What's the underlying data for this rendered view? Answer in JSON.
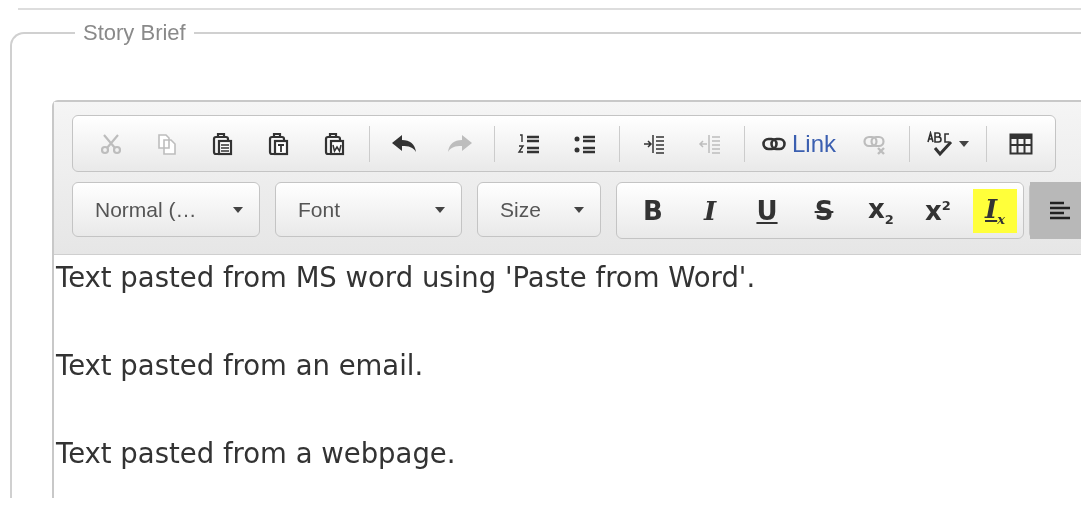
{
  "fieldset": {
    "legend": "Story Brief"
  },
  "toolbar": {
    "row_1": [
      {
        "kind": "button",
        "disabled": true
      },
      {
        "kind": "button",
        "disabled": true
      },
      {
        "kind": "button",
        "disabled": false
      },
      {
        "kind": "button",
        "disabled": false
      },
      {
        "kind": "button",
        "disabled": false
      },
      {
        "kind": "separator"
      },
      {
        "kind": "button",
        "disabled": false
      },
      {
        "kind": "button",
        "disabled": true
      },
      {
        "kind": "separator"
      },
      {
        "kind": "button",
        "disabled": false
      },
      {
        "kind": "button",
        "disabled": false
      },
      {
        "kind": "separator"
      },
      {
        "kind": "button",
        "disabled": false
      },
      {
        "kind": "button",
        "disabled": true
      },
      {
        "kind": "separator"
      },
      {
        "kind": "button",
        "label": "Link",
        "disabled": false
      },
      {
        "kind": "button",
        "disabled": true
      },
      {
        "kind": "separator"
      },
      {
        "kind": "menu-button",
        "disabled": false
      },
      {
        "kind": "separator"
      },
      {
        "kind": "button",
        "disabled": false
      }
    ],
    "row_2": [
      {
        "kind": "combo",
        "label": "Normal (…"
      },
      {
        "kind": "combo",
        "label": "Font"
      },
      {
        "kind": "combo",
        "label": "Size"
      },
      {
        "kind": "format-group",
        "buttons": [
          {
            "label": "B",
            "highlighted": false
          },
          {
            "label": "I",
            "highlighted": false
          },
          {
            "label": "U",
            "highlighted": false
          },
          {
            "label": "S",
            "highlighted": false
          },
          {
            "label": "x$_{2}$",
            "highlighted": false
          },
          {
            "label": "x$^{2}$",
            "highlighted": false
          },
          {
            "label": "I$_{x}$",
            "highlighted": true
          }
        ]
      },
      {
        "kind": "align-group",
        "buttons": [
          {
            "on": true
          }
        ]
      }
    ]
  },
  "content": {
    "paragraphs": [
      "Text pasted from MS word using 'Paste from Word'.",
      "Text pasted from an email.",
      "Text pasted from a webpage."
    ]
  }
}
